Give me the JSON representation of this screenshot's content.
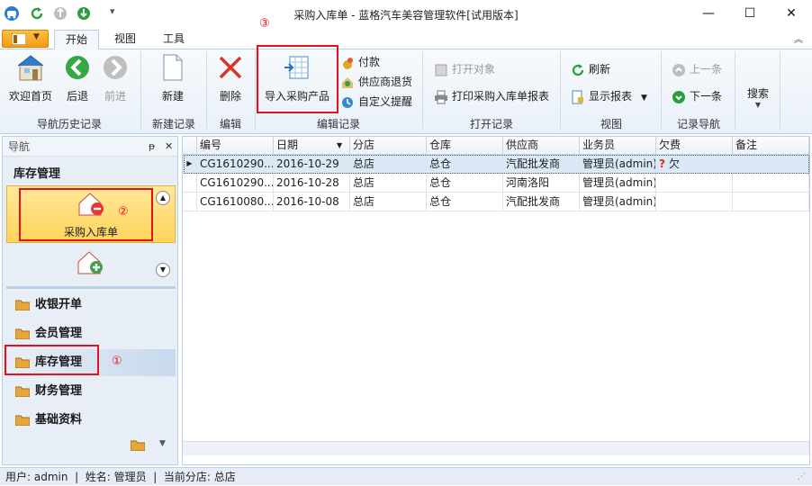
{
  "window": {
    "title": "采购入库单 - 蓝格汽车美容管理软件[试用版本]",
    "minimize": "—",
    "maximize": "☐",
    "close": "✕"
  },
  "tabs": [
    {
      "label": "开始"
    },
    {
      "label": "视图"
    },
    {
      "label": "工具"
    }
  ],
  "ribbon": {
    "nav": {
      "home": "欢迎首页",
      "back": "后退",
      "forward": "前进",
      "label": "导航历史记录"
    },
    "create": {
      "new": "新建",
      "label": "新建记录"
    },
    "edit": {
      "delete": "删除",
      "label": "编辑"
    },
    "editrec": {
      "import": "导入采购产品",
      "pay": "付款",
      "return": "供应商退货",
      "remind": "自定义提醒",
      "label": "编辑记录"
    },
    "open": {
      "open_obj": "打开对象",
      "print": "打印采购入库单报表",
      "label": "打开记录"
    },
    "view": {
      "refresh": "刷新",
      "show_report": "显示报表",
      "label": "视图"
    },
    "recnav": {
      "prev": "上一条",
      "next": "下一条",
      "label": "记录导航"
    },
    "search": {
      "label": "搜索"
    }
  },
  "annotations": {
    "one": "①",
    "two": "②",
    "three": "③"
  },
  "nav": {
    "header": "导航",
    "pin": "ᵽ",
    "close": "✕",
    "section_title": "库存管理",
    "item_selected": "采购入库单",
    "buttons": [
      "收银开单",
      "会员管理",
      "库存管理",
      "财务管理",
      "基础资料"
    ]
  },
  "grid": {
    "columns": [
      "编号",
      "日期",
      "分店",
      "仓库",
      "供应商",
      "业务员",
      "欠费",
      "备注"
    ],
    "rows": [
      {
        "id": "CG1610290...",
        "date": "2016-10-29",
        "branch": "总店",
        "warehouse": "总仓",
        "supplier": "汽配批发商",
        "staff": "管理员(admin)",
        "owe": "欠",
        "note": ""
      },
      {
        "id": "CG1610290...",
        "date": "2016-10-28",
        "branch": "总店",
        "warehouse": "总仓",
        "supplier": "河南洛阳",
        "staff": "管理员(admin)",
        "owe": "",
        "note": ""
      },
      {
        "id": "CG1610080...",
        "date": "2016-10-08",
        "branch": "总店",
        "warehouse": "总仓",
        "supplier": "汽配批发商",
        "staff": "管理员(admin)",
        "owe": "",
        "note": ""
      }
    ]
  },
  "status": {
    "text": "用户: admin  |  姓名: 管理员  |  当前分店: 总店"
  },
  "colors": {
    "accent": "#1e73c8",
    "annotation": "#e8101d"
  }
}
